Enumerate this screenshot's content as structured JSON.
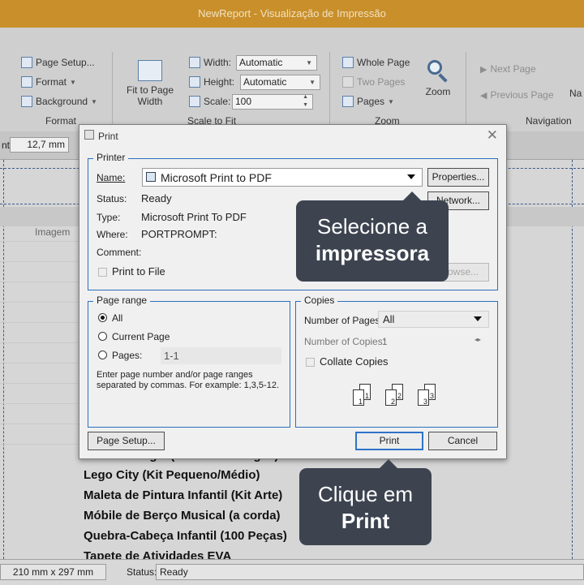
{
  "window": {
    "title": "NewReport - Visualização de Impressão"
  },
  "ribbon": {
    "format_group": {
      "page_setup": "Page Setup...",
      "format": "Format",
      "background": "Background",
      "label": "Format"
    },
    "fit_group": {
      "fit_to_page_width_line1": "Fit to Page",
      "fit_to_page_width_line2": "Width",
      "width_label": "Width:",
      "width_value": "Automatic",
      "height_label": "Height:",
      "height_value": "Automatic",
      "scale_label": "Scale:",
      "scale_value": "100",
      "label": "Scale to Fit"
    },
    "zoom_group": {
      "whole_page": "Whole Page",
      "two_pages": "Two Pages",
      "pages": "Pages",
      "zoom": "Zoom",
      "label": "Zoom"
    },
    "navigation_group": {
      "next_page": "Next Page",
      "previous_page": "Previous Page",
      "nav_cut": "Na",
      "label": "Navigation"
    }
  },
  "subbar": {
    "label_cut": "nt:",
    "value": "12,7 mm"
  },
  "preview": {
    "column_header": "Imagem",
    "items": [
      "Lego City (Kit Pequeno/Médio)",
      "Maleta de Pintura Infantil (Kit Arte)",
      "Móbile de Berço Musical (a corda)",
      "Quebra-Cabeça Infantil (100 Peças)",
      "Tapete de Atividades EVA"
    ],
    "partial_item": "Lanterna Vigia (Noturna ao Vigas)"
  },
  "statusbar": {
    "page_size": "210 mm x 297 mm",
    "status_label": "Status:",
    "status_value": "Ready"
  },
  "dialog": {
    "title": "Print",
    "printer": {
      "legend": "Printer",
      "name_label": "Name:",
      "name_value": "Microsoft Print to PDF",
      "properties_button": "Properties...",
      "network_button": "Network...",
      "browse_button": "Browse...",
      "status_label": "Status:",
      "status_value": "Ready",
      "type_label": "Type:",
      "type_value": "Microsoft Print To PDF",
      "where_label": "Where:",
      "where_value": "PORTPROMPT:",
      "comment_label": "Comment:",
      "print_to_file": "Print to File"
    },
    "page_range": {
      "legend": "Page range",
      "all": "All",
      "current_page": "Current Page",
      "pages": "Pages:",
      "pages_value": "1-1",
      "hint_line1": "Enter page number and/or page ranges",
      "hint_line2": "separated by commas. For example: 1,3,5-12."
    },
    "copies": {
      "legend": "Copies",
      "number_of_pages_label": "Number of Pages:",
      "number_of_pages_value": "All",
      "number_of_copies_label": "Number of Copies:",
      "number_of_copies_value": "1",
      "collate": "Collate Copies",
      "collate_icons": [
        "1",
        "1",
        "2",
        "2",
        "3",
        "3"
      ]
    },
    "buttons": {
      "page_setup": "Page Setup...",
      "print": "Print",
      "cancel": "Cancel"
    }
  },
  "callouts": {
    "select_printer_line1": "Selecione a",
    "select_printer_line2": "impressora",
    "click_print_line1": "Clique em",
    "click_print_line2": "Print"
  },
  "colors": {
    "titlebar": "#c98f2a",
    "group_border": "#2a6fbf",
    "callout_bg": "#3d4450"
  }
}
